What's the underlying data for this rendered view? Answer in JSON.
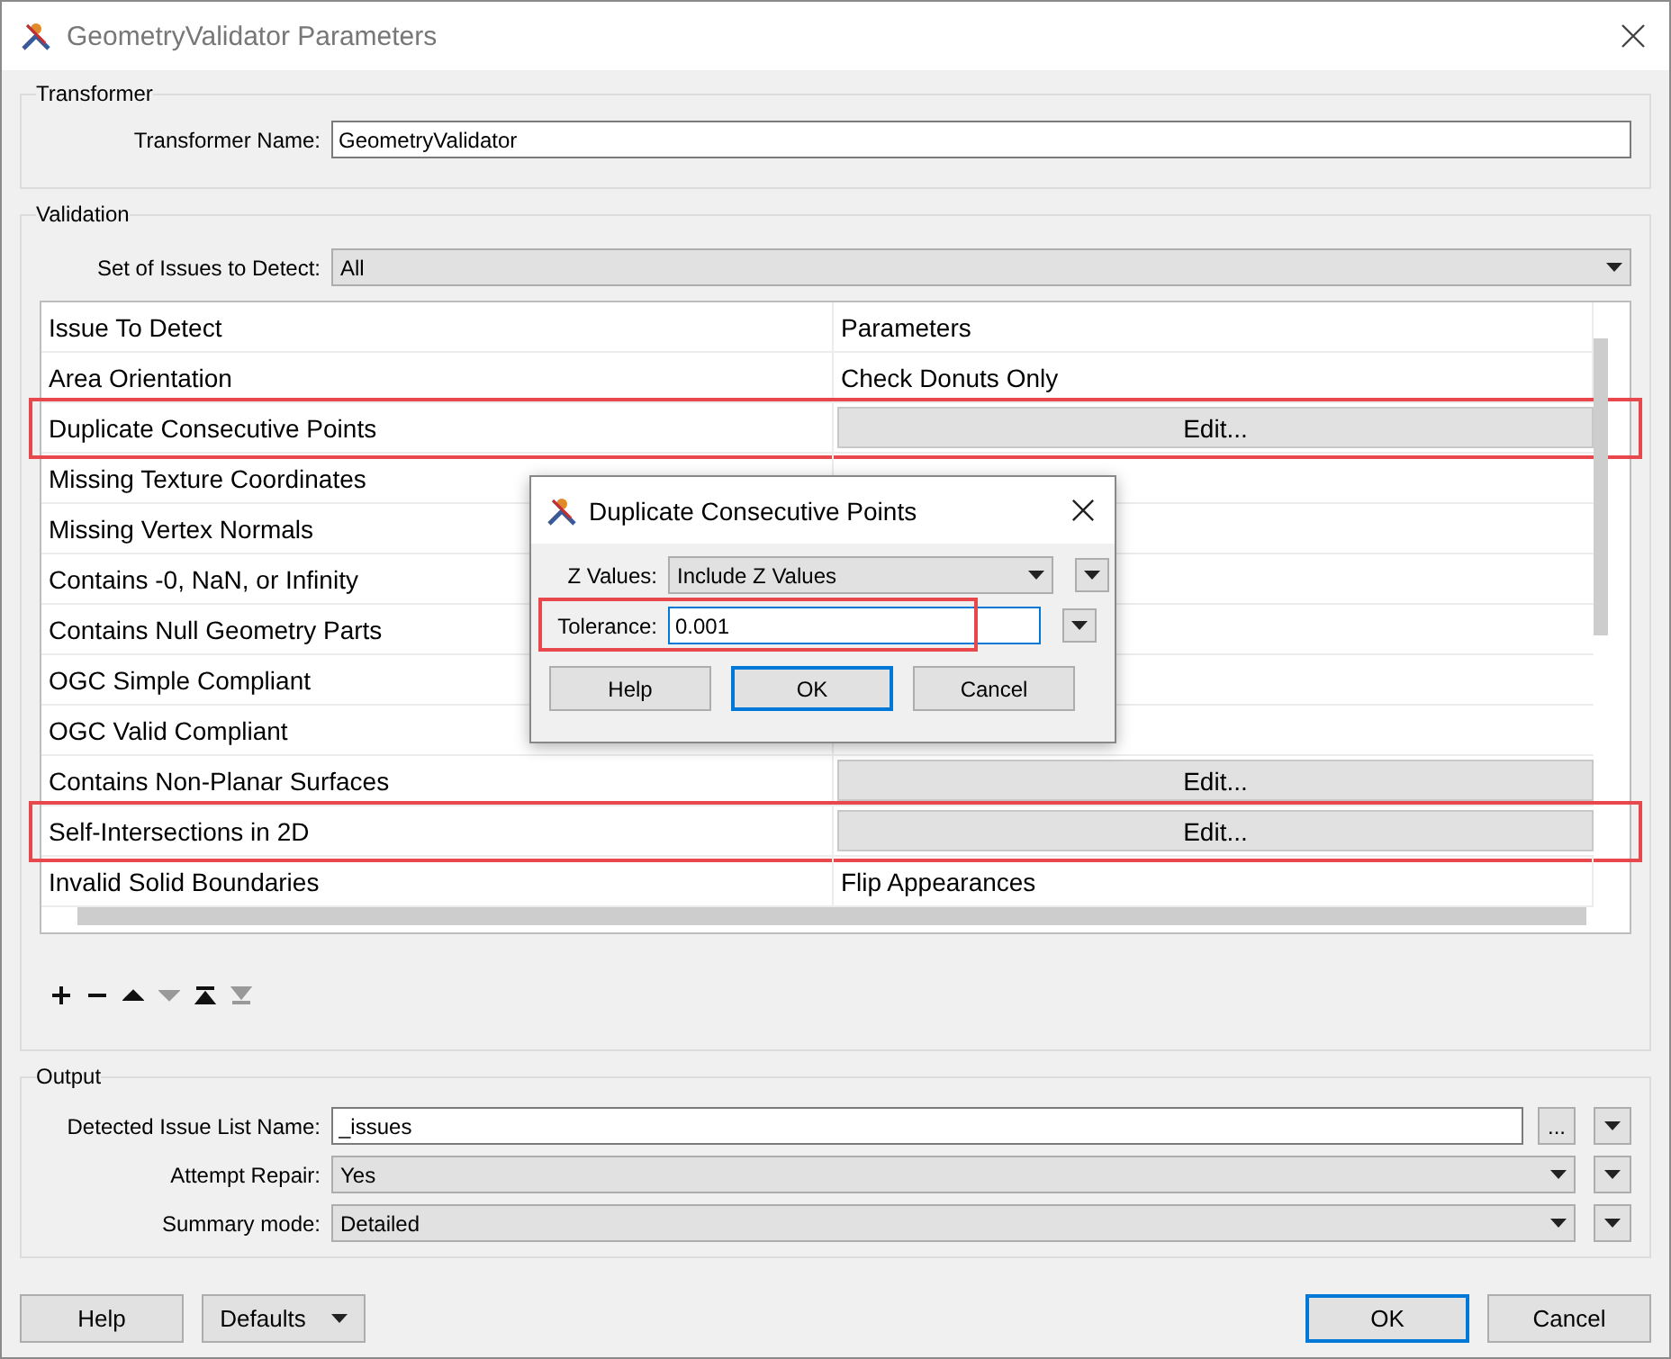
{
  "window": {
    "title": "GeometryValidator Parameters"
  },
  "transformer": {
    "legend": "Transformer",
    "name_label": "Transformer Name:",
    "name_value": "GeometryValidator"
  },
  "validation": {
    "legend": "Validation",
    "set_label": "Set of Issues to Detect:",
    "set_value": "All",
    "columns": [
      "Issue To Detect",
      "Parameters"
    ],
    "rows": [
      {
        "issue": "Area Orientation",
        "highlighted": false,
        "param": {
          "kind": "text",
          "text": "Check Donuts Only"
        }
      },
      {
        "issue": "Duplicate Consecutive Points",
        "highlighted": true,
        "param": {
          "kind": "edit",
          "text": "Edit..."
        }
      },
      {
        "issue": "Missing Texture Coordinates",
        "highlighted": false
      },
      {
        "issue": "Missing Vertex Normals",
        "highlighted": false
      },
      {
        "issue": "Contains -0, NaN, or Infinity",
        "highlighted": false
      },
      {
        "issue": "Contains Null Geometry Parts",
        "highlighted": false
      },
      {
        "issue": "OGC Simple Compliant",
        "highlighted": false
      },
      {
        "issue": "OGC Valid Compliant",
        "highlighted": false
      },
      {
        "issue": "Contains Non-Planar Surfaces",
        "highlighted": false,
        "param": {
          "kind": "edit",
          "text": "Edit..."
        }
      },
      {
        "issue": "Self-Intersections in 2D",
        "highlighted": true,
        "param": {
          "kind": "edit",
          "text": "Edit..."
        }
      },
      {
        "issue": "Invalid Solid Boundaries",
        "highlighted": false,
        "param": {
          "kind": "text",
          "text": "Flip Appearances"
        }
      }
    ],
    "tools": [
      {
        "kind": "add",
        "disabled": false
      },
      {
        "kind": "remove",
        "disabled": false
      },
      {
        "kind": "up",
        "disabled": false
      },
      {
        "kind": "down",
        "disabled": true
      },
      {
        "kind": "top",
        "disabled": false
      },
      {
        "kind": "bottom",
        "disabled": true
      }
    ]
  },
  "output": {
    "legend": "Output",
    "fields": [
      {
        "kind": "text",
        "label": "Detected Issue List Name:",
        "value": "_issues",
        "more": "..."
      },
      {
        "kind": "select",
        "label": "Attempt Repair:",
        "value": "Yes"
      },
      {
        "kind": "select",
        "label": "Summary mode:",
        "value": "Detailed"
      }
    ]
  },
  "buttons": {
    "help": "Help",
    "defaults": "Defaults",
    "ok": "OK",
    "cancel": "Cancel"
  },
  "popup": {
    "title": "Duplicate Consecutive Points",
    "z_label": "Z Values:",
    "z_value": "Include Z Values",
    "tol_label": "Tolerance:",
    "tol_value": "0.001",
    "tol_highlighted": true,
    "help": "Help",
    "ok": "OK",
    "cancel": "Cancel"
  }
}
